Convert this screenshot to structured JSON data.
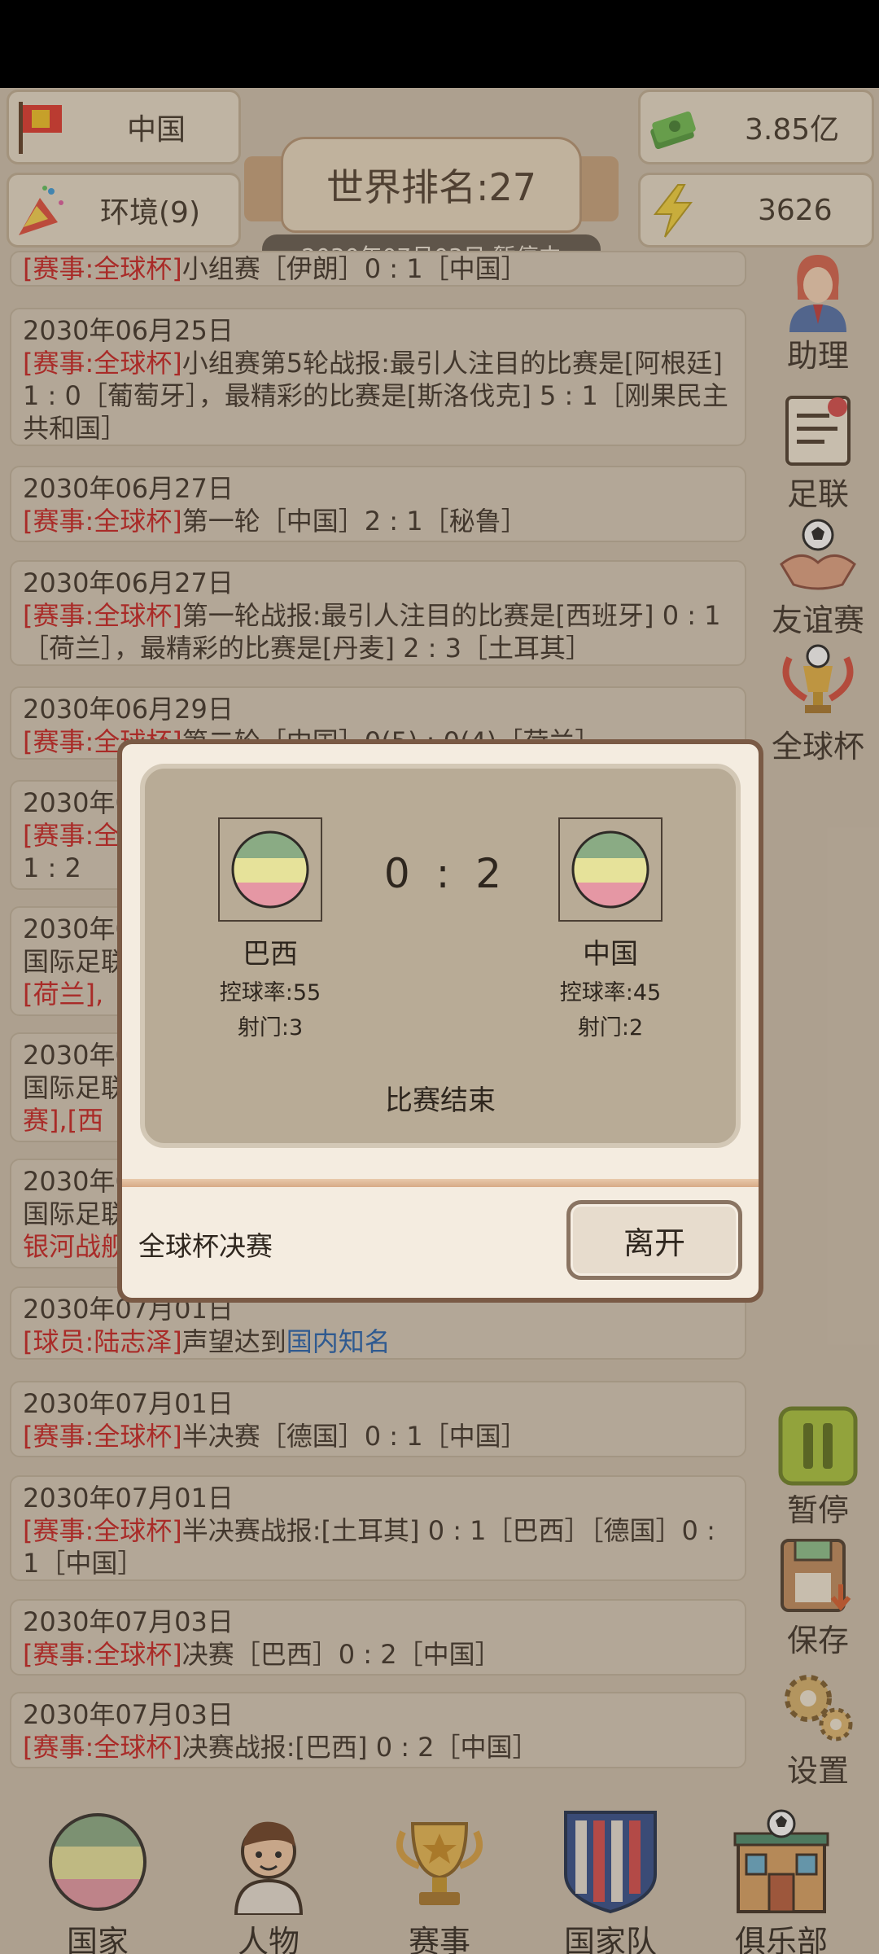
{
  "header": {
    "country": "中国",
    "environment": "环境(9)",
    "money": "3.85亿",
    "energy": "3626",
    "world_rank": "世界排名:27",
    "date_status": "2030年07月03日 暂停中"
  },
  "news": [
    {
      "date": "",
      "tag": "[赛事:全球杯]",
      "body": "小组赛［伊朗］0 : 1［中国］"
    },
    {
      "date": "2030年06月25日",
      "tag": "[赛事:全球杯]",
      "body": "小组赛第5轮战报:最引人注目的比赛是[阿根廷] 1 : 0［葡萄牙］，最精彩的比赛是[斯洛伐克] 5 : 1［刚果民主共和国］"
    },
    {
      "date": "2030年06月27日",
      "tag": "[赛事:全球杯]",
      "body": "第一轮［中国］2 : 1［秘鲁］"
    },
    {
      "date": "2030年06月27日",
      "tag": "[赛事:全球杯]",
      "body": "第一轮战报:最引人注目的比赛是[西班牙] 0 : 1［荷兰］，最精彩的比赛是[丹麦] 2 : 3［土耳其］"
    },
    {
      "date": "2030年06月29日",
      "tag": "[赛事:全球杯]",
      "body": "第二轮［中国］0(5) : 0(4)［荷兰］"
    },
    {
      "date": "2030年0",
      "tag": "[赛事:全",
      "body": "1 : 2"
    },
    {
      "date": "2030年0",
      "line2": "国际足联",
      "tag": "[荷兰],",
      "body": ""
    },
    {
      "date": "2030年0",
      "line2": "国际足联",
      "tag": "赛],[西",
      "body": ""
    },
    {
      "date": "2030年0",
      "line2": "国际足联",
      "tag": "银河战舰",
      "body": ""
    },
    {
      "date": "2030年07月01日",
      "tag": "[球员:陆志泽]",
      "body": "声望达到",
      "link": "国内知名"
    },
    {
      "date": "2030年07月01日",
      "tag": "[赛事:全球杯]",
      "body": "半决赛［德国］0 : 1［中国］"
    },
    {
      "date": "2030年07月01日",
      "tag": "[赛事:全球杯]",
      "body": "半决赛战报:[土耳其] 0 : 1［巴西］［德国］0 : 1［中国］"
    },
    {
      "date": "2030年07月03日",
      "tag": "[赛事:全球杯]",
      "body": "决赛［巴西］0 : 2［中国］"
    },
    {
      "date": "2030年07月03日",
      "tag": "[赛事:全球杯]",
      "body": "决赛战报:[巴西] 0 : 2［中国］"
    }
  ],
  "sidebar": {
    "assistant": "助理",
    "federation": "足联",
    "friendly": "友谊赛",
    "global_cup": "全球杯",
    "pause": "暂停",
    "save": "保存",
    "settings": "设置"
  },
  "dialog": {
    "home": {
      "name": "巴西",
      "possession": "控球率:55",
      "shots": "射门:3"
    },
    "away": {
      "name": "中国",
      "possession": "控球率:45",
      "shots": "射门:2"
    },
    "score": "0 : 2",
    "status": "比赛结束",
    "title": "全球杯决赛",
    "leave": "离开"
  },
  "bottom_nav": {
    "country": "国家",
    "people": "人物",
    "events": "赛事",
    "national_team": "国家队",
    "club": "俱乐部"
  },
  "colors": {
    "flag_top": "#8aab84",
    "flag_mid": "#e6e29a",
    "flag_bot": "#e597a4"
  }
}
